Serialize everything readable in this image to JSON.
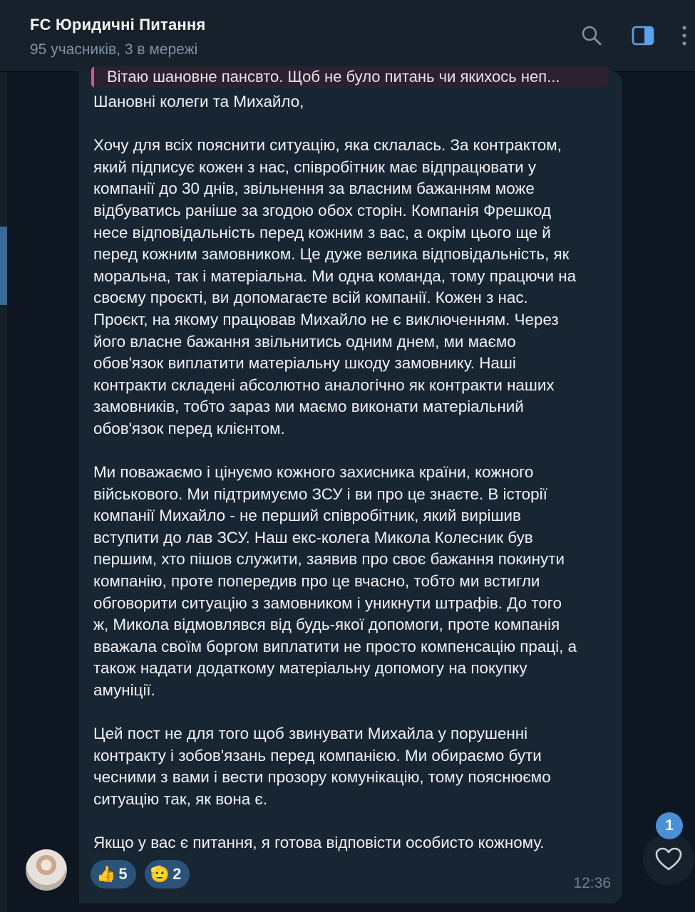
{
  "header": {
    "title": "FC Юридичні Питання",
    "subtitle": "95 учасників, 3 в мережі"
  },
  "reply": {
    "text": "Вітаю шановне пансвто. Щоб не було питань чи якихось неп..."
  },
  "message": {
    "lines": [
      "Шановні колеги та Михайло,",
      "",
      "Хочу для всіх пояснити ситуацію, яка склалась. За контрактом,",
      "який підписує кожен з нас, співробітник має відпрацювати у",
      "компанії до 30 днів, звільнення за власним бажанням може",
      "відбуватись раніше за згодою обох сторін. Компанія Фрешкод",
      "несе відповідальність перед кожним з вас, а окрім цього ще й",
      "перед кожним замовником. Це дуже велика відповідальність, як",
      "моральна, так і матеріальна. Ми одна команда, тому працючи на",
      "своєму проєкті, ви допомагаєте всій компанії. Кожен з нас.",
      "Проєкт, на якому працював Михайло не є виключенням. Через",
      "його власне бажання звільнитись одним днем, ми маємо",
      "обов'язок виплатити матеріальну шкоду замовнику. Наші",
      "контракти складені абсолютно аналогічно як контракти наших",
      "замовників, тобто зараз ми маємо виконати матеріальний",
      "обов'язок перед клієнтом.",
      "",
      "Ми поважаємо і цінуємо кожного захисника країни, кожного",
      "військового. Ми підтримуємо ЗСУ і ви про це знаєте. В історії",
      "компанії Михайло - не перший співробітник, який вирішив",
      "вступити до лав ЗСУ. Наш екс-колега Микола Колесник був",
      "першим, хто пішов служити, заявив про своє бажання покинути",
      "компанію, проте попередив про це вчасно, тобто ми встигли",
      "обговорити ситуацію з замовником і уникнути штрафів. До того",
      "ж, Микола відмовлявся від будь-якої допомоги, проте компанія",
      "вважала своїм боргом виплатити не просто компенсацію праці, а",
      "також надати додаткому матеріальну допомогу на покупку",
      "амуніції.",
      "",
      "Цей пост не для того щоб звинувати Михайла у порушенні",
      "контракту і зобов'язань перед компанією. Ми обираємо бути",
      "чесними з вами і вести прозору комунікацію, тому пояснюємо",
      "ситуацію так, як вона є.",
      "",
      "Якщо у вас є питання, я готова відповісти особисто кожному."
    ],
    "time": "12:36"
  },
  "reactions": [
    {
      "emoji": "👍",
      "count": "5"
    },
    {
      "emoji": "🫡",
      "count": "2"
    }
  ],
  "fab": {
    "badge": "1",
    "icon": "heart-icon"
  },
  "colors": {
    "background": "#0e1621",
    "header": "#17212b",
    "bubble": "#182533",
    "reaction": "#2b5278",
    "accent": "#4b8fd6",
    "reply_bar": "#e0538a"
  }
}
